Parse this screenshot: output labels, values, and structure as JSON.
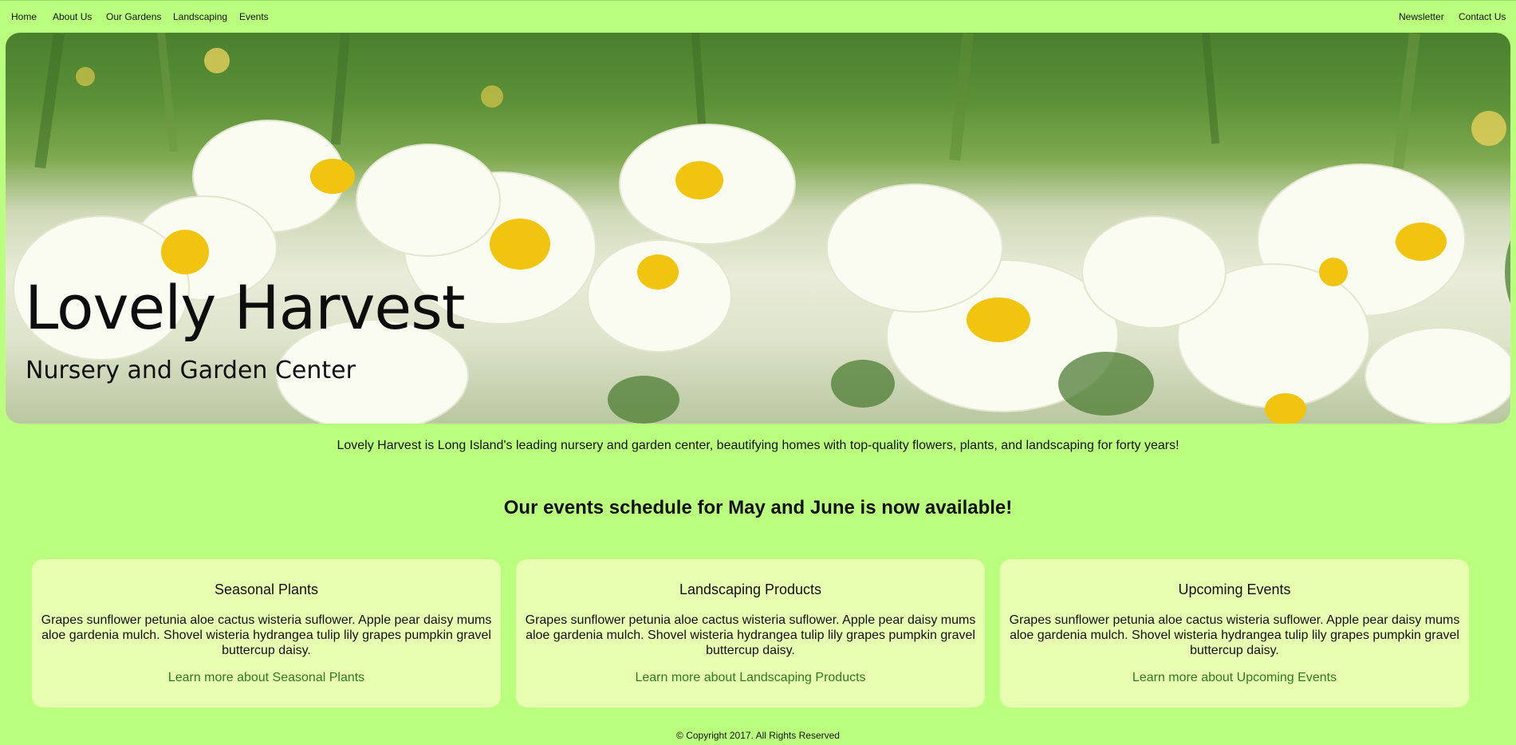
{
  "nav": {
    "left": [
      "Home",
      "About Us",
      "Our Gardens",
      "Landscaping",
      "Events"
    ],
    "right": [
      "Newsletter",
      "Contact Us"
    ]
  },
  "hero": {
    "title": "Lovely Harvest",
    "subtitle": "Nursery and Garden Center"
  },
  "intro": "Lovely Harvest is Long Island's leading nursery and garden center, beautifying homes with top-quality flowers, plants, and landscaping for forty years!",
  "headline": "Our events schedule for May and June is now available!",
  "cards": [
    {
      "title": "Seasonal Plants",
      "body": "Grapes sunflower petunia aloe cactus wisteria suflower. Apple pear daisy mums aloe gardenia mulch. Shovel wisteria hydrangea tulip lily grapes pumpkin gravel buttercup daisy.",
      "link": "Learn more about Seasonal Plants"
    },
    {
      "title": "Landscaping Products",
      "body": "Grapes sunflower petunia aloe cactus wisteria suflower. Apple pear daisy mums aloe gardenia mulch. Shovel wisteria hydrangea tulip lily grapes pumpkin gravel buttercup daisy.",
      "link": "Learn more about Landscaping Products"
    },
    {
      "title": "Upcoming Events",
      "body": "Grapes sunflower petunia aloe cactus wisteria suflower. Apple pear daisy mums aloe gardenia mulch. Shovel wisteria hydrangea tulip lily grapes pumpkin gravel buttercup daisy.",
      "link": "Learn more about Upcoming Events"
    }
  ],
  "footer": "© Copyright 2017. All Rights Reserved",
  "colors": {
    "background": "#bbff7f",
    "card": "#e8ffb1",
    "link": "#2f7a1f"
  }
}
